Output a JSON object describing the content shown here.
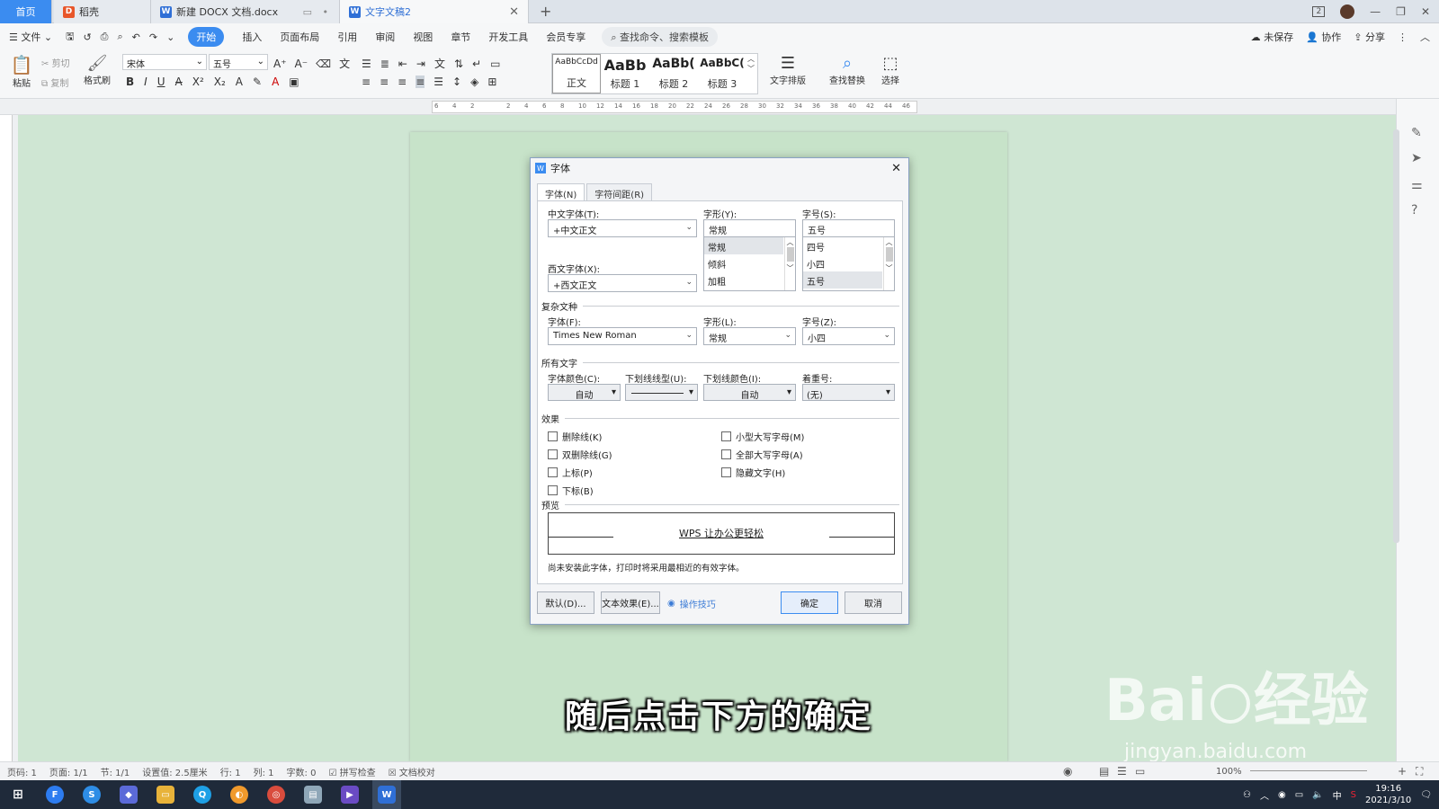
{
  "tabs": {
    "home": "首页",
    "docer": "稻壳",
    "docx": "新建 DOCX 文档.docx",
    "active": "文字文稿2",
    "new_tab": "+"
  },
  "window": {
    "badge": "2",
    "min": "—",
    "max": "❐",
    "close": "✕"
  },
  "menu": {
    "file": "文件",
    "items": [
      "开始",
      "插入",
      "页面布局",
      "引用",
      "审阅",
      "视图",
      "章节",
      "开发工具",
      "会员专享"
    ],
    "search": "查找命令、搜索模板",
    "unsaved": "未保存",
    "collab": "协作",
    "share": "分享"
  },
  "ribbon": {
    "paste": "粘贴",
    "cut": "剪切",
    "copy": "复制",
    "format_painter": "格式刷",
    "font_name": "宋体",
    "font_size": "五号",
    "styles": [
      {
        "big": "AaBbCcDd",
        "label": "正文"
      },
      {
        "big": "AaBb",
        "label": "标题 1"
      },
      {
        "big": "AaBb(",
        "label": "标题 2"
      },
      {
        "big": "AaBbC(",
        "label": "标题 3"
      }
    ],
    "text_layout": "文字排版",
    "find_replace": "查找替换",
    "select": "选择"
  },
  "ruler": [
    "6",
    "4",
    "2",
    "",
    "2",
    "4",
    "6",
    "8",
    "10",
    "12",
    "14",
    "16",
    "18",
    "20",
    "22",
    "24",
    "26",
    "28",
    "30",
    "32",
    "34",
    "36",
    "38",
    "40",
    "42",
    "44",
    "46"
  ],
  "dialog": {
    "title": "字体",
    "tab_font": "字体(N)",
    "tab_spacing": "字符间距(R)",
    "cn_font_label": "中文字体(T):",
    "cn_font_value": "+中文正文",
    "style_label": "字形(Y):",
    "style_value": "常规",
    "style_options": [
      "常规",
      "倾斜",
      "加粗"
    ],
    "size_label": "字号(S):",
    "size_value": "五号",
    "size_options": [
      "四号",
      "小四",
      "五号"
    ],
    "west_font_label": "西文字体(X):",
    "west_font_value": "+西文正文",
    "complex_section": "复杂文种",
    "complex_font_label": "字体(F):",
    "complex_font_value": "Times New Roman",
    "complex_style_label": "字形(L):",
    "complex_style_value": "常规",
    "complex_size_label": "字号(Z):",
    "complex_size_value": "小四",
    "all_text_section": "所有文字",
    "font_color_label": "字体颜色(C):",
    "font_color_value": "自动",
    "underline_type_label": "下划线线型(U):",
    "underline_type_value": "",
    "underline_color_label": "下划线颜色(I):",
    "underline_color_value": "自动",
    "emphasis_label": "着重号:",
    "emphasis_value": "(无)",
    "effects_section": "效果",
    "effects_left": [
      "删除线(K)",
      "双删除线(G)",
      "上标(P)",
      "下标(B)"
    ],
    "effects_right": [
      "小型大写字母(M)",
      "全部大写字母(A)",
      "隐藏文字(H)"
    ],
    "preview_section": "预览",
    "preview_text": "WPS 让办公更轻松",
    "note": "尚未安装此字体，打印时将采用最相近的有效字体。",
    "btn_default": "默认(D)...",
    "btn_text_effect": "文本效果(E)...",
    "tips": "操作技巧",
    "btn_ok": "确定",
    "btn_cancel": "取消"
  },
  "subtitle": "随后点击下方的确定",
  "watermark": {
    "brand": "Bai",
    "brand2": "经验",
    "url": "jingyan.baidu.com"
  },
  "status": {
    "page": "页码: 1",
    "pages": "页面: 1/1",
    "section": "节: 1/1",
    "setting": "设置值: 2.5厘米",
    "line": "行: 1",
    "col": "列: 1",
    "words": "字数: 0",
    "spell": "拼写检查",
    "proof": "文档校对",
    "zoom": "100%"
  },
  "taskbar": {
    "time": "19:16",
    "date": "2021/3/10",
    "ime": "中"
  },
  "colors": {
    "accent": "#3b8cf0",
    "doc_bg": "#cfe6d3",
    "taskbar": "#1f2a3a"
  }
}
